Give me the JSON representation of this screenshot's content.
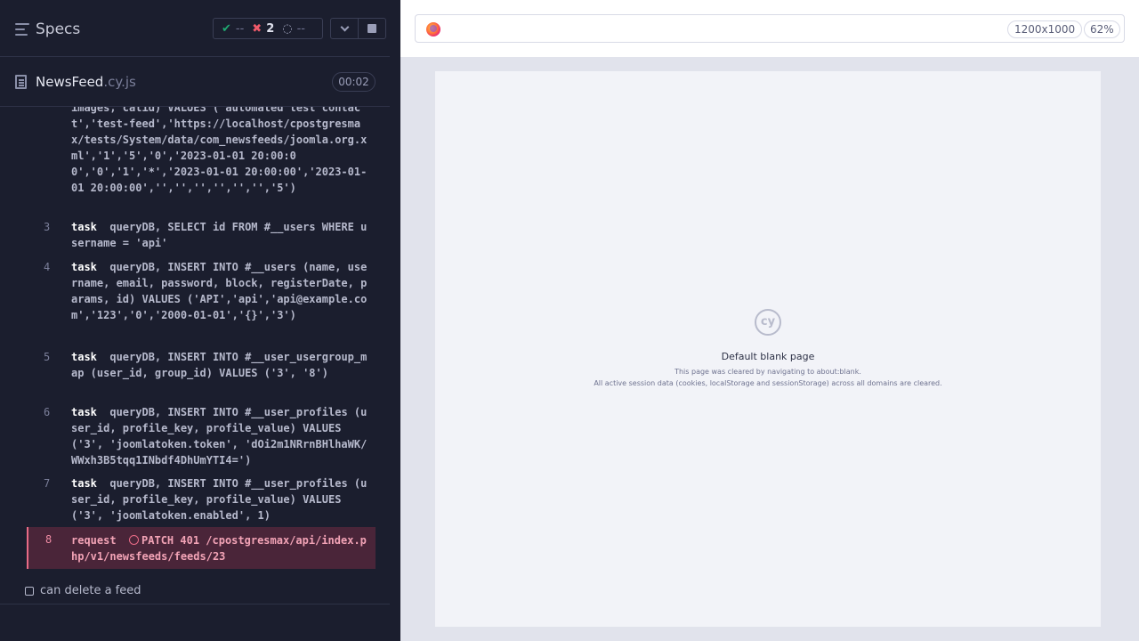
{
  "header": {
    "title": "Specs",
    "stats": {
      "passed": "--",
      "failed": "2",
      "pending": "--"
    }
  },
  "file": {
    "name": "NewsFeed",
    "ext": ".cy.js",
    "duration": "00:02"
  },
  "commands": [
    {
      "num": "",
      "keyword": "",
      "text": "images, catid) VALUES ('automated test contact','test-feed','https://localhost/cpostgresmax/tests/System/data/com_newsfeeds/joomla.org.xml','1','5','0','2023-01-01 20:00:00','0','1','*','2023-01-01 20:00:00','2023-01-01 20:00:00','','','','','','','5')"
    },
    {
      "num": "3",
      "keyword": "task",
      "text": "queryDB, SELECT id FROM #__users WHERE username = 'api'"
    },
    {
      "num": "4",
      "keyword": "task",
      "text": "queryDB, INSERT INTO #__users (name, username, email, password, block, registerDate, params, id) VALUES ('API','api','api@example.com','123','0','2000-01-01','{}','3')"
    },
    {
      "num": "5",
      "keyword": "task",
      "text": "queryDB, INSERT INTO #__user_usergroup_map (user_id, group_id) VALUES ('3', '8')"
    },
    {
      "num": "6",
      "keyword": "task",
      "text": "queryDB, INSERT INTO #__user_profiles (user_id, profile_key, profile_value) VALUES ('3', 'joomlatoken.token', 'dOi2m1NRrnBHlhaWK/WWxh3B5tqq1INbdf4DhUmYTI4=')"
    },
    {
      "num": "7",
      "keyword": "task",
      "text": "queryDB, INSERT INTO #__user_profiles (user_id, profile_key, profile_value) VALUES ('3', 'joomlatoken.enabled', 1)"
    },
    {
      "num": "8",
      "keyword": "request",
      "text": "PATCH 401 /cpostgresmax/api/index.php/v1/newsfeeds/feeds/23"
    }
  ],
  "next_test": "can delete a feed",
  "aut": {
    "viewport": "1200x1000",
    "zoom": "62%",
    "blank_title": "Default blank page",
    "blank_desc1": "This page was cleared by navigating to about:blank.",
    "blank_desc2": "All active session data (cookies, localStorage and sessionStorage) across all domains are cleared.",
    "logo_text": "cy"
  }
}
